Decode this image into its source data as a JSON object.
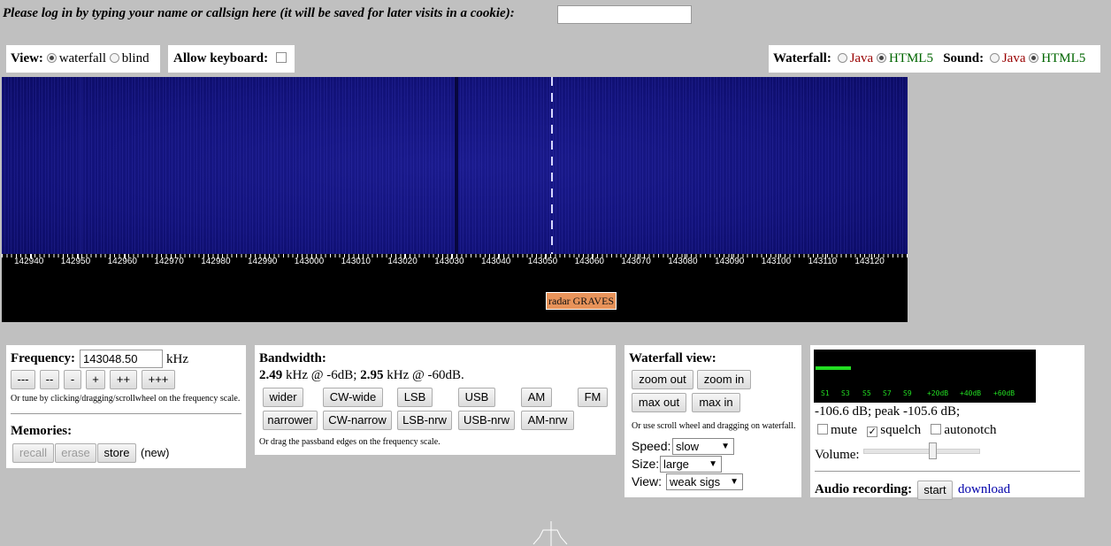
{
  "login": {
    "prompt": "Please log in by typing your name or callsign here (it will be saved for later visits in a cookie):",
    "value": ""
  },
  "view": {
    "label": "View:",
    "options": [
      "waterfall",
      "blind"
    ],
    "selected": "waterfall"
  },
  "keyboard": {
    "label": "Allow keyboard:"
  },
  "waterfall_mode": {
    "label": "Waterfall:",
    "java": "Java",
    "html5": "HTML5"
  },
  "sound_mode": {
    "label": "Sound:",
    "java": "Java",
    "html5": "HTML5"
  },
  "scale": {
    "ticks": [
      "142940",
      "142950",
      "142960",
      "142970",
      "142980",
      "142990",
      "143000",
      "143010",
      "143020",
      "143030",
      "143040",
      "143050",
      "143060",
      "143070",
      "143080",
      "143090",
      "143100",
      "143110",
      "143120"
    ],
    "label": "radar GRAVES"
  },
  "frequency": {
    "label": "Frequency:",
    "value": "143048.50",
    "unit": "kHz",
    "steps": [
      "---",
      "--",
      "-",
      "+",
      "++",
      "+++"
    ],
    "hint": "Or tune by clicking/dragging/scrollwheel on the frequency scale."
  },
  "memories": {
    "label": "Memories:",
    "recall": "recall",
    "erase": "erase",
    "store": "store",
    "status": "(new)"
  },
  "bandwidth": {
    "label": "Bandwidth:",
    "bw1": "2.49",
    "txt1": " kHz @ -6dB; ",
    "bw2": "2.95",
    "txt2": " kHz @ -60dB.",
    "row1": [
      "wider",
      "CW-wide",
      "LSB",
      "USB",
      "AM",
      "FM"
    ],
    "row2": [
      "narrower",
      "CW-narrow",
      "LSB-nrw",
      "USB-nrw",
      "AM-nrw"
    ],
    "hint": "Or drag the passband edges on the frequency scale."
  },
  "waterfall_view": {
    "label": "Waterfall view:",
    "zoom_out": "zoom out",
    "zoom_in": "zoom in",
    "max_out": "max out",
    "max_in": "max in",
    "hint": "Or use scroll wheel and dragging on waterfall.",
    "speed_label": "Speed:",
    "speed": "slow",
    "size_label": "Size:",
    "size": "large",
    "view_label": "View:",
    "view": "weak sigs"
  },
  "smeter": {
    "scale": [
      "S1",
      "S3",
      "S5",
      "S7",
      "S9",
      "+20dB",
      "+40dB",
      "+60dB"
    ],
    "reading": "-106.6 dB; peak -105.6 dB;",
    "level": 0.16,
    "colors": {
      "bar": "#22dd22",
      "text": "#22dd22",
      "bg": "#000000"
    }
  },
  "audio": {
    "mute": "mute",
    "squelch": "squelch",
    "autonotch": "autonotch",
    "volume_label": "Volume:",
    "volume": 0.6,
    "recording_label": "Audio recording:",
    "start": "start",
    "download": "download"
  },
  "colors": {
    "waterfall_bg": "#0a0a6e",
    "scale_bg": "#000000",
    "label_bg": "#e8935a"
  }
}
